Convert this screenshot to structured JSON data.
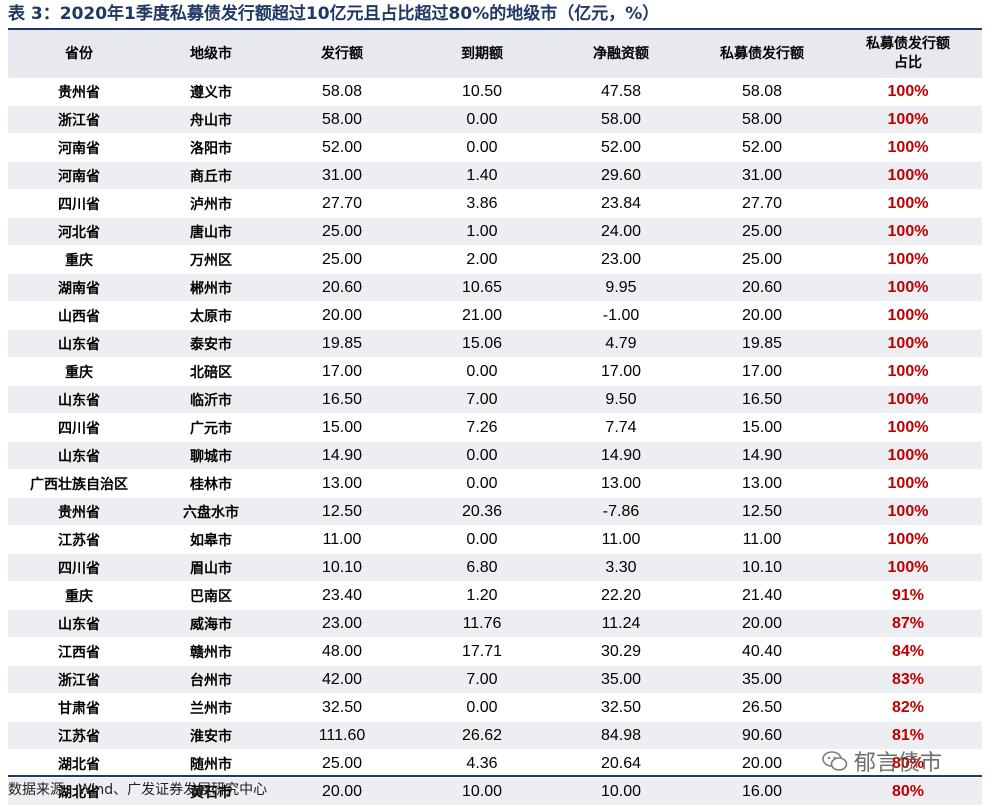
{
  "title": "表 3：2020年1季度私募债发行额超过10亿元且占比超过80%的地级市（亿元，%）",
  "columns": [
    "省份",
    "地级市",
    "发行额",
    "到期额",
    "净融资额",
    "私募债发行额",
    "私募债发行额占比"
  ],
  "rows": [
    [
      "贵州省",
      "遵义市",
      "58.08",
      "10.50",
      "47.58",
      "58.08",
      "100%"
    ],
    [
      "浙江省",
      "舟山市",
      "58.00",
      "0.00",
      "58.00",
      "58.00",
      "100%"
    ],
    [
      "河南省",
      "洛阳市",
      "52.00",
      "0.00",
      "52.00",
      "52.00",
      "100%"
    ],
    [
      "河南省",
      "商丘市",
      "31.00",
      "1.40",
      "29.60",
      "31.00",
      "100%"
    ],
    [
      "四川省",
      "泸州市",
      "27.70",
      "3.86",
      "23.84",
      "27.70",
      "100%"
    ],
    [
      "河北省",
      "唐山市",
      "25.00",
      "1.00",
      "24.00",
      "25.00",
      "100%"
    ],
    [
      "重庆",
      "万州区",
      "25.00",
      "2.00",
      "23.00",
      "25.00",
      "100%"
    ],
    [
      "湖南省",
      "郴州市",
      "20.60",
      "10.65",
      "9.95",
      "20.60",
      "100%"
    ],
    [
      "山西省",
      "太原市",
      "20.00",
      "21.00",
      "-1.00",
      "20.00",
      "100%"
    ],
    [
      "山东省",
      "泰安市",
      "19.85",
      "15.06",
      "4.79",
      "19.85",
      "100%"
    ],
    [
      "重庆",
      "北碚区",
      "17.00",
      "0.00",
      "17.00",
      "17.00",
      "100%"
    ],
    [
      "山东省",
      "临沂市",
      "16.50",
      "7.00",
      "9.50",
      "16.50",
      "100%"
    ],
    [
      "四川省",
      "广元市",
      "15.00",
      "7.26",
      "7.74",
      "15.00",
      "100%"
    ],
    [
      "山东省",
      "聊城市",
      "14.90",
      "0.00",
      "14.90",
      "14.90",
      "100%"
    ],
    [
      "广西壮族自治区",
      "桂林市",
      "13.00",
      "0.00",
      "13.00",
      "13.00",
      "100%"
    ],
    [
      "贵州省",
      "六盘水市",
      "12.50",
      "20.36",
      "-7.86",
      "12.50",
      "100%"
    ],
    [
      "江苏省",
      "如皋市",
      "11.00",
      "0.00",
      "11.00",
      "11.00",
      "100%"
    ],
    [
      "四川省",
      "眉山市",
      "10.10",
      "6.80",
      "3.30",
      "10.10",
      "100%"
    ],
    [
      "重庆",
      "巴南区",
      "23.40",
      "1.20",
      "22.20",
      "21.40",
      "91%"
    ],
    [
      "山东省",
      "威海市",
      "23.00",
      "11.76",
      "11.24",
      "20.00",
      "87%"
    ],
    [
      "江西省",
      "赣州市",
      "48.00",
      "17.71",
      "30.29",
      "40.40",
      "84%"
    ],
    [
      "浙江省",
      "台州市",
      "42.00",
      "7.00",
      "35.00",
      "35.00",
      "83%"
    ],
    [
      "甘肃省",
      "兰州市",
      "32.50",
      "0.00",
      "32.50",
      "26.50",
      "82%"
    ],
    [
      "江苏省",
      "淮安市",
      "111.60",
      "26.62",
      "84.98",
      "90.60",
      "81%"
    ],
    [
      "湖北省",
      "随州市",
      "25.00",
      "4.36",
      "20.64",
      "20.00",
      "80%"
    ],
    [
      "湖北省",
      "黄石市",
      "20.00",
      "10.00",
      "10.00",
      "16.00",
      "80%"
    ]
  ],
  "source": "数据来源：Wind、广发证券发展研究中心",
  "watermark": "郁言债市",
  "colors": {
    "title": "#1f3864",
    "header_bg": "#e7e9ee",
    "stripe_bg": "#eceef2",
    "pct_red": "#c00000"
  }
}
